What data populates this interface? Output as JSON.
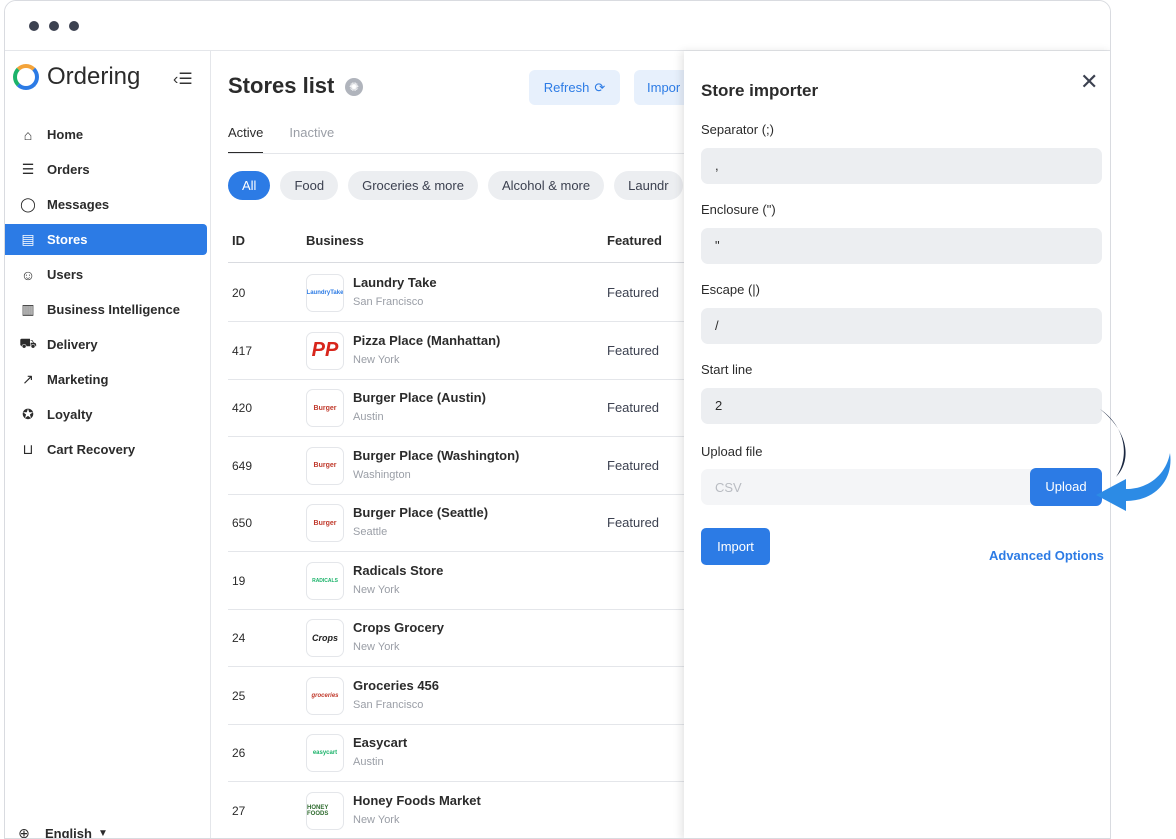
{
  "app": {
    "name": "Ordering",
    "collapse_icon": "sidebar-collapse-icon"
  },
  "sidebar": {
    "items": [
      {
        "label": "Home",
        "icon": "home-icon",
        "glyph": "⌂"
      },
      {
        "label": "Orders",
        "icon": "list-icon",
        "glyph": "☰"
      },
      {
        "label": "Messages",
        "icon": "chat-icon",
        "glyph": "◯"
      },
      {
        "label": "Stores",
        "icon": "store-icon",
        "glyph": "▤"
      },
      {
        "label": "Users",
        "icon": "users-icon",
        "glyph": "☺"
      },
      {
        "label": "Business Intelligence",
        "icon": "bar-chart-icon",
        "glyph": "▥"
      },
      {
        "label": "Delivery",
        "icon": "truck-icon",
        "glyph": "⛟"
      },
      {
        "label": "Marketing",
        "icon": "trend-icon",
        "glyph": "↗"
      },
      {
        "label": "Loyalty",
        "icon": "medal-icon",
        "glyph": "✪"
      },
      {
        "label": "Cart Recovery",
        "icon": "cart-icon",
        "glyph": "⊔"
      }
    ],
    "active_index": 3,
    "language": "English"
  },
  "page": {
    "title": "Stores list",
    "refresh_label": "Refresh",
    "import_label": "Impor",
    "tabs": [
      "Active",
      "Inactive"
    ],
    "categories": [
      "All",
      "Food",
      "Groceries & more",
      "Alcohol & more",
      "Laundr"
    ],
    "columns": {
      "id": "ID",
      "business": "Business",
      "featured": "Featured"
    }
  },
  "stores": [
    {
      "id": "20",
      "name": "Laundry Take",
      "city": "San Francisco",
      "featured": "Featured",
      "logo": "LaundryTake"
    },
    {
      "id": "417",
      "name": "Pizza Place (Manhattan)",
      "city": "New York",
      "featured": "Featured",
      "logo": "PP"
    },
    {
      "id": "420",
      "name": "Burger Place (Austin)",
      "city": "Austin",
      "featured": "Featured",
      "logo": "Burger"
    },
    {
      "id": "649",
      "name": "Burger Place (Washington)",
      "city": "Washington",
      "featured": "Featured",
      "logo": "Burger"
    },
    {
      "id": "650",
      "name": "Burger Place (Seattle)",
      "city": "Seattle",
      "featured": "Featured",
      "logo": "Burger"
    },
    {
      "id": "19",
      "name": "Radicals Store",
      "city": "New York",
      "featured": "",
      "logo": "RADICALS"
    },
    {
      "id": "24",
      "name": "Crops Grocery",
      "city": "New York",
      "featured": "",
      "logo": "Crops"
    },
    {
      "id": "25",
      "name": "Groceries 456",
      "city": "San Francisco",
      "featured": "",
      "logo": "groceries"
    },
    {
      "id": "26",
      "name": "Easycart",
      "city": "Austin",
      "featured": "",
      "logo": "easycart"
    },
    {
      "id": "27",
      "name": "Honey Foods Market",
      "city": "New York",
      "featured": "",
      "logo": "HONEY FOODS"
    }
  ],
  "importer": {
    "title": "Store importer",
    "separator_label": "Separator (;)",
    "separator_value": ",",
    "enclosure_label": "Enclosure (\")",
    "enclosure_value": "\"",
    "escape_label": "Escape (|)",
    "escape_value": "/",
    "start_line_label": "Start line",
    "start_line_value": "2",
    "upload_label": "Upload file",
    "upload_placeholder": "CSV",
    "upload_button": "Upload",
    "import_button": "Import",
    "advanced_link": "Advanced Options"
  },
  "colors": {
    "accent": "#2c7be5",
    "chip_bg": "#eceef1",
    "field_bg": "#eceef1",
    "text": "#2b2b2b"
  }
}
